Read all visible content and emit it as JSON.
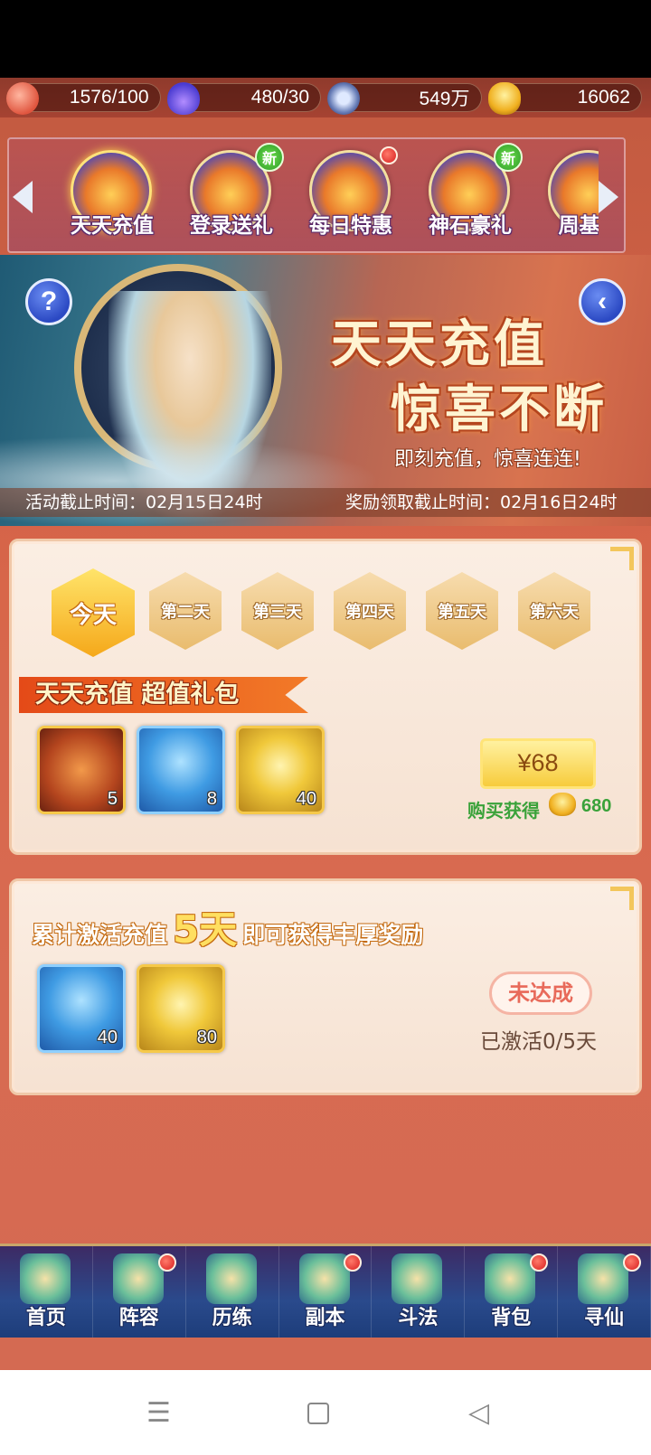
{
  "resources": [
    {
      "icon": "peach-icon",
      "value": "1576/100"
    },
    {
      "icon": "flame-icon",
      "value": "480/30"
    },
    {
      "icon": "coin-icon",
      "value": "549万"
    },
    {
      "icon": "ingot-icon",
      "value": "16062"
    }
  ],
  "activities": [
    {
      "label": "天天充值",
      "selected": true,
      "badge": ""
    },
    {
      "label": "登录送礼",
      "selected": false,
      "badge": "新"
    },
    {
      "label": "每日特惠",
      "selected": false,
      "badge": "dot"
    },
    {
      "label": "神石豪礼",
      "selected": false,
      "badge": "新"
    },
    {
      "label": "周基金",
      "selected": false,
      "badge": ""
    }
  ],
  "banner": {
    "help_label": "?",
    "back_label": "‹",
    "title_line1": "天天充值",
    "title_line2": "惊喜不断",
    "subtitle": "即刻充值，惊喜连连!",
    "activity_deadline": "活动截止时间：02月15日24时",
    "reward_deadline": "奖励领取截止时间：02月16日24时"
  },
  "days": [
    "今天",
    "第二天",
    "第三天",
    "第四天",
    "第五天",
    "第六天"
  ],
  "pack": {
    "title": "天天充值 超值礼包",
    "items": [
      {
        "icon": "brush-item-icon",
        "quantity": "5"
      },
      {
        "icon": "hero-card-icon",
        "quantity": "8"
      },
      {
        "icon": "gold-card-icon",
        "quantity": "40"
      }
    ],
    "price": "¥68",
    "purchase_label": "购买获得",
    "purchase_amount": "680"
  },
  "cumulative": {
    "title_prefix": "累计激活充值",
    "title_days": "5天",
    "title_suffix": "即可获得丰厚奖励",
    "items": [
      {
        "icon": "hero-card-icon",
        "quantity": "40"
      },
      {
        "icon": "gold-card-icon",
        "quantity": "80"
      }
    ],
    "status_button": "未达成",
    "progress_text": "已激活0/5天"
  },
  "bottom_nav": [
    {
      "label": "首页",
      "dot": false
    },
    {
      "label": "阵容",
      "dot": true
    },
    {
      "label": "历练",
      "dot": false
    },
    {
      "label": "副本",
      "dot": true
    },
    {
      "label": "斗法",
      "dot": false
    },
    {
      "label": "背包",
      "dot": true
    },
    {
      "label": "寻仙",
      "dot": true
    }
  ],
  "system_nav": {
    "menu": "☰",
    "back": "◁"
  }
}
